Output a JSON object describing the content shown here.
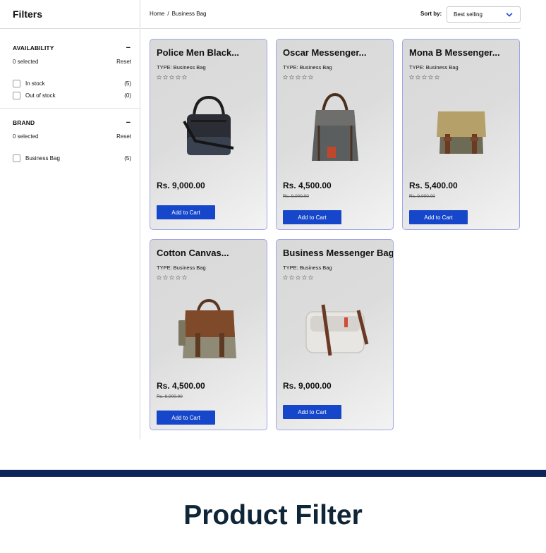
{
  "sidebar": {
    "title": "Filters",
    "availability": {
      "heading": "AVAILABILITY",
      "collapse": "−",
      "selected": "0 selected",
      "reset": "Reset",
      "options": [
        {
          "label": "In stock",
          "count": "(5)"
        },
        {
          "label": "Out of stock",
          "count": "(0)"
        }
      ]
    },
    "brand": {
      "heading": "BRAND",
      "collapse": "−",
      "selected": "0 selected",
      "reset": "Reset",
      "options": [
        {
          "label": "Business Bag",
          "count": "(5)"
        }
      ]
    }
  },
  "breadcrumb": {
    "home": "Home",
    "separator": "/",
    "current": "Business Bag"
  },
  "sort": {
    "label": "Sort by:",
    "value": "Best selling"
  },
  "products": [
    {
      "title": "Police Men Black...",
      "type": "TYPE: Business Bag",
      "price": "Rs. 9,000.00",
      "compare": "",
      "button": "Add to Cart",
      "image": "black-laptop-bag"
    },
    {
      "title": "Oscar Messenger...",
      "type": "TYPE: Business Bag",
      "price": "Rs. 4,500.00",
      "compare": "Rs. 9,000.00",
      "button": "Add to Cart",
      "image": "grey-canvas-tote"
    },
    {
      "title": "Mona B Messenger...",
      "type": "TYPE: Business Bag",
      "price": "Rs. 5,400.00",
      "compare": "Rs. 9,000.00",
      "button": "Add to Cart",
      "image": "khaki-messenger"
    },
    {
      "title": "Cotton Canvas...",
      "type": "TYPE: Business Bag",
      "price": "Rs. 4,500.00",
      "compare": "Rs. 9,000.00",
      "button": "Add to Cart",
      "image": "brown-canvas-messenger"
    },
    {
      "title": "Business Messenger Bag",
      "type": "TYPE: Business Bag",
      "price": "Rs. 9,000.00",
      "compare": "",
      "button": "Add to Cart",
      "image": "white-messenger"
    }
  ],
  "footer": {
    "title": "Product Filter"
  },
  "colors": {
    "accent": "#1646c9",
    "card_border": "#9ea6e6",
    "footer_bar": "#0d2559",
    "footer_text": "#0f2538"
  }
}
